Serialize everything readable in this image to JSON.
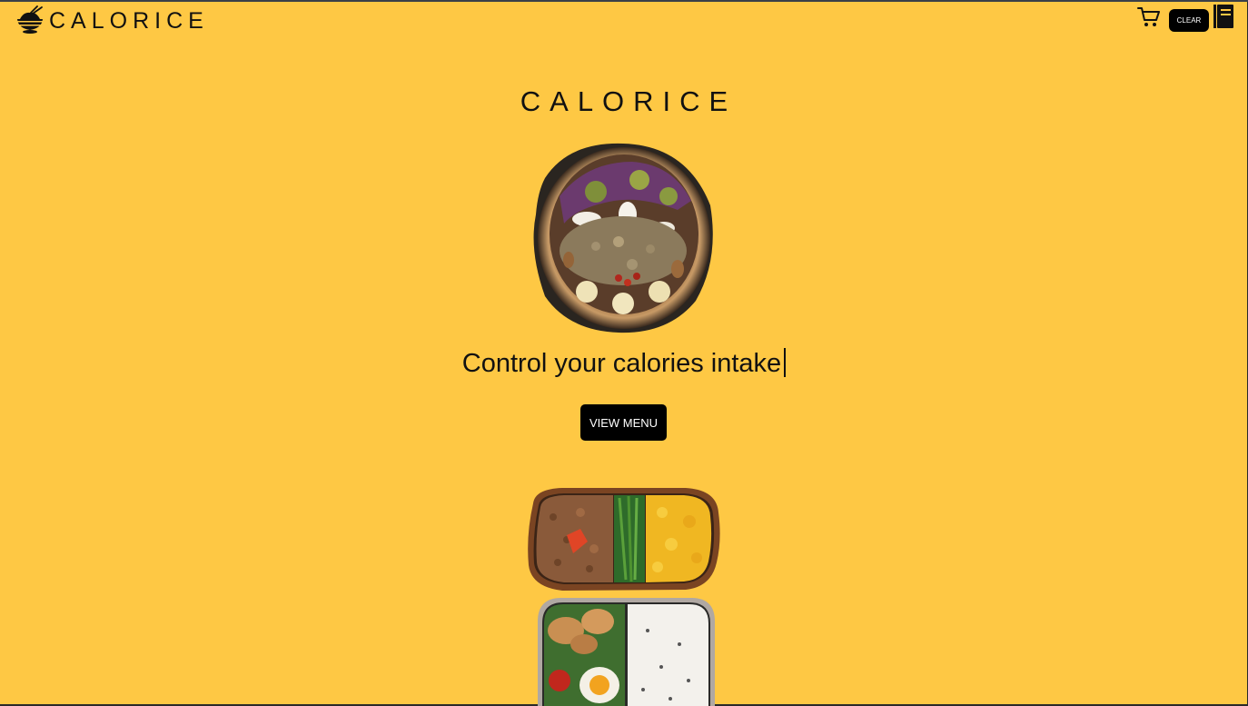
{
  "header": {
    "logo_text": "CALORICE",
    "clear_label": "CLEAR",
    "icons": {
      "logo": "rice-bowl-icon",
      "cart": "cart-icon",
      "menu_book": "menu-book-icon"
    }
  },
  "hero": {
    "title": "CALORICE",
    "tagline": "Control your calories intake",
    "cta_label": "VIEW MENU",
    "images": {
      "bowl": "acai-bowl-image",
      "bento_top": "bento-minced-meat-greens-egg",
      "bento_bottom": "bento-chicken-rice-egg"
    }
  },
  "colors": {
    "background": "#FEC844",
    "button_bg": "#000000",
    "button_text": "#FFFFFF",
    "text": "#111111"
  }
}
